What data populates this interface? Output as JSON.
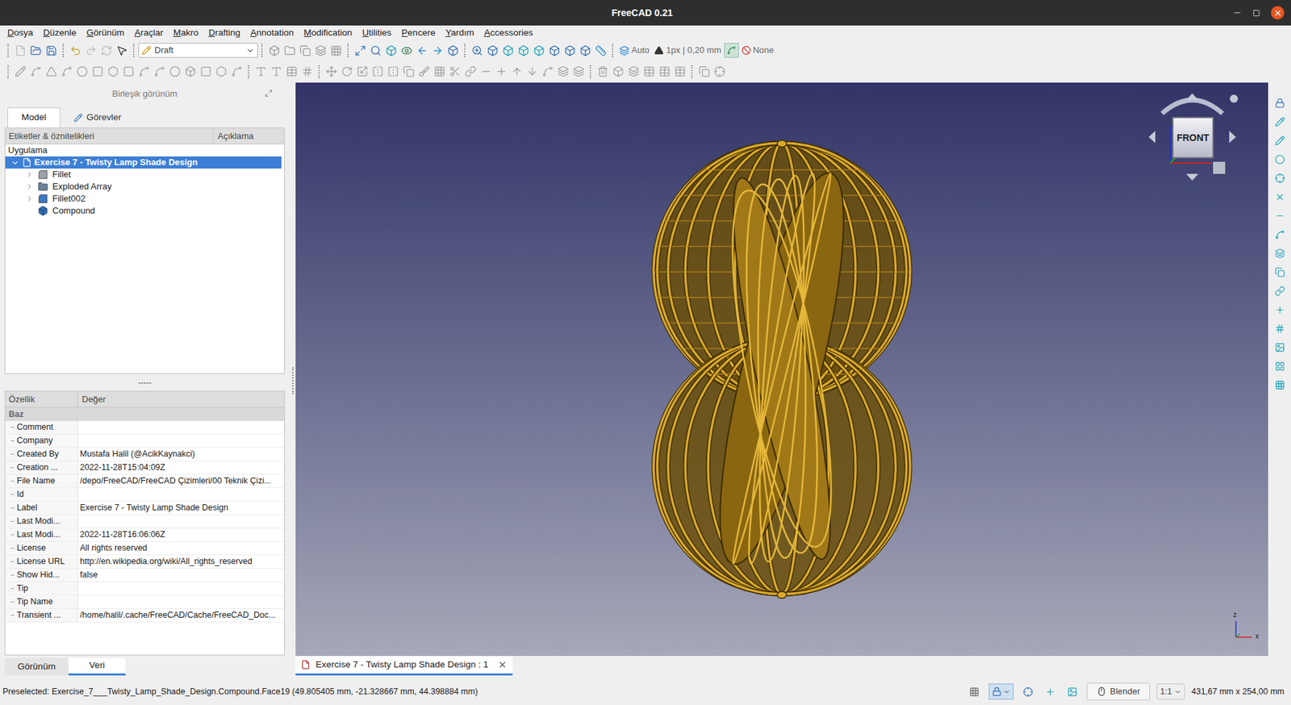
{
  "window": {
    "title": "FreeCAD 0.21"
  },
  "menu": [
    "Dosya",
    "Düzenle",
    "Görünüm",
    "Araçlar",
    "Makro",
    "Drafting",
    "Annotation",
    "Modification",
    "Utilities",
    "Pencere",
    "Yardım",
    "Accessories"
  ],
  "toolbar": {
    "workbench": "Draft",
    "snap_style": "Auto",
    "line": "1px | 0,20 mm",
    "style": "None"
  },
  "combo_view": {
    "title": "Birleşik görünüm",
    "tabs": [
      {
        "label": "Model",
        "selected": true
      },
      {
        "label": "Görevler",
        "selected": false
      }
    ]
  },
  "tree": {
    "columns": [
      "Etiketler & öznitelikleri",
      "Açıklama"
    ],
    "root": "Uygulama",
    "document": {
      "label": "Exercise 7 - Twisty Lamp Shade Design",
      "selected": true,
      "expanded": true
    },
    "items": [
      {
        "label": "Fillet",
        "kind": "fillet",
        "color": "#9ca3af",
        "expandable": true,
        "expanded": false
      },
      {
        "label": "Exploded Array",
        "kind": "group",
        "color": "#6b7f99",
        "expandable": true,
        "expanded": false
      },
      {
        "label": "Fillet002",
        "kind": "fillet",
        "color": "#3b78c4",
        "expandable": true,
        "expanded": false
      },
      {
        "label": "Compound",
        "kind": "compound",
        "color": "#2f6db5",
        "expandable": false,
        "expanded": false
      }
    ]
  },
  "splitter": "-----",
  "properties": {
    "columns": [
      "Özellik",
      "Değer"
    ],
    "group": "Baz",
    "rows": [
      {
        "name": "Comment",
        "value": ""
      },
      {
        "name": "Company",
        "value": ""
      },
      {
        "name": "Created By",
        "value": "Mustafa Halil (@AcikKaynakci)"
      },
      {
        "name": "Creation ...",
        "value": "2022-11-28T15:04:09Z"
      },
      {
        "name": "File Name",
        "value": "/depo/FreeCAD/FreeCAD Çizimleri/00 Teknik Çizi..."
      },
      {
        "name": "Id",
        "value": ""
      },
      {
        "name": "Label",
        "value": "Exercise 7 - Twisty Lamp Shade Design"
      },
      {
        "name": "Last Modi...",
        "value": ""
      },
      {
        "name": "Last Modi...",
        "value": "2022-11-28T16:06:06Z"
      },
      {
        "name": "License",
        "value": "All rights reserved"
      },
      {
        "name": "License URL",
        "value": "http://en.wikipedia.org/wiki/All_rights_reserved"
      },
      {
        "name": "Show Hid...",
        "value": "false"
      },
      {
        "name": "Tip",
        "value": ""
      },
      {
        "name": "Tip Name",
        "value": ""
      },
      {
        "name": "Transient ...",
        "value": "/home/halil/.cache/FreeCAD/Cache/FreeCAD_Doc..."
      }
    ]
  },
  "bottom_tabs": [
    {
      "label": "Görünüm",
      "selected": false
    },
    {
      "label": "Veri",
      "selected": true
    }
  ],
  "viewport": {
    "nav_cube": "FRONT",
    "axes": [
      "z",
      "x"
    ]
  },
  "document_tabs": [
    {
      "label": "Exercise 7 - Twisty Lamp Shade Design : 1",
      "selected": true
    }
  ],
  "status_bar": {
    "message": "Preselected: Exercise_7___Twisty_Lamp_Shade_Design.Compound.Face19 (49.805405 mm, -21.328667 mm, 44.398884 mm)",
    "navigation": "Blender",
    "zoom": "1:1",
    "dimensions": "431,67 mm x 254,00 mm"
  }
}
